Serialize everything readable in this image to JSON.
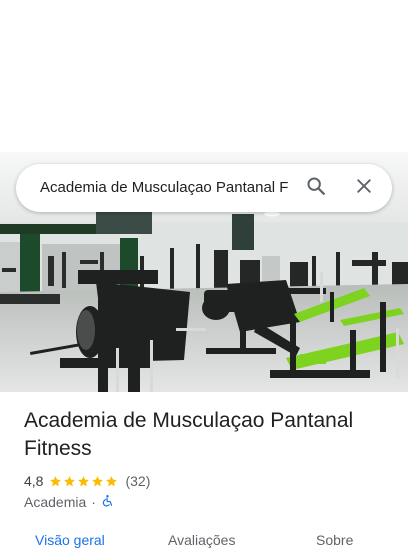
{
  "search": {
    "query": "Academia de Musculaçao Pantanal F",
    "search_icon": "search-icon",
    "close_icon": "close-icon"
  },
  "place": {
    "title": "Academia de Musculaçao Pantanal Fitness",
    "rating": "4,8",
    "stars": 5,
    "review_count": "(32)",
    "category": "Academia",
    "separator": "·",
    "accessibility_icon": "wheelchair-accessible-icon"
  },
  "tabs": [
    {
      "label": "Visão geral",
      "active": true
    },
    {
      "label": "Avaliações",
      "active": false
    },
    {
      "label": "Sobre",
      "active": false
    }
  ],
  "colors": {
    "accent": "#1a73e8",
    "star": "#fbbc04",
    "machine_green": "#7ed321"
  }
}
